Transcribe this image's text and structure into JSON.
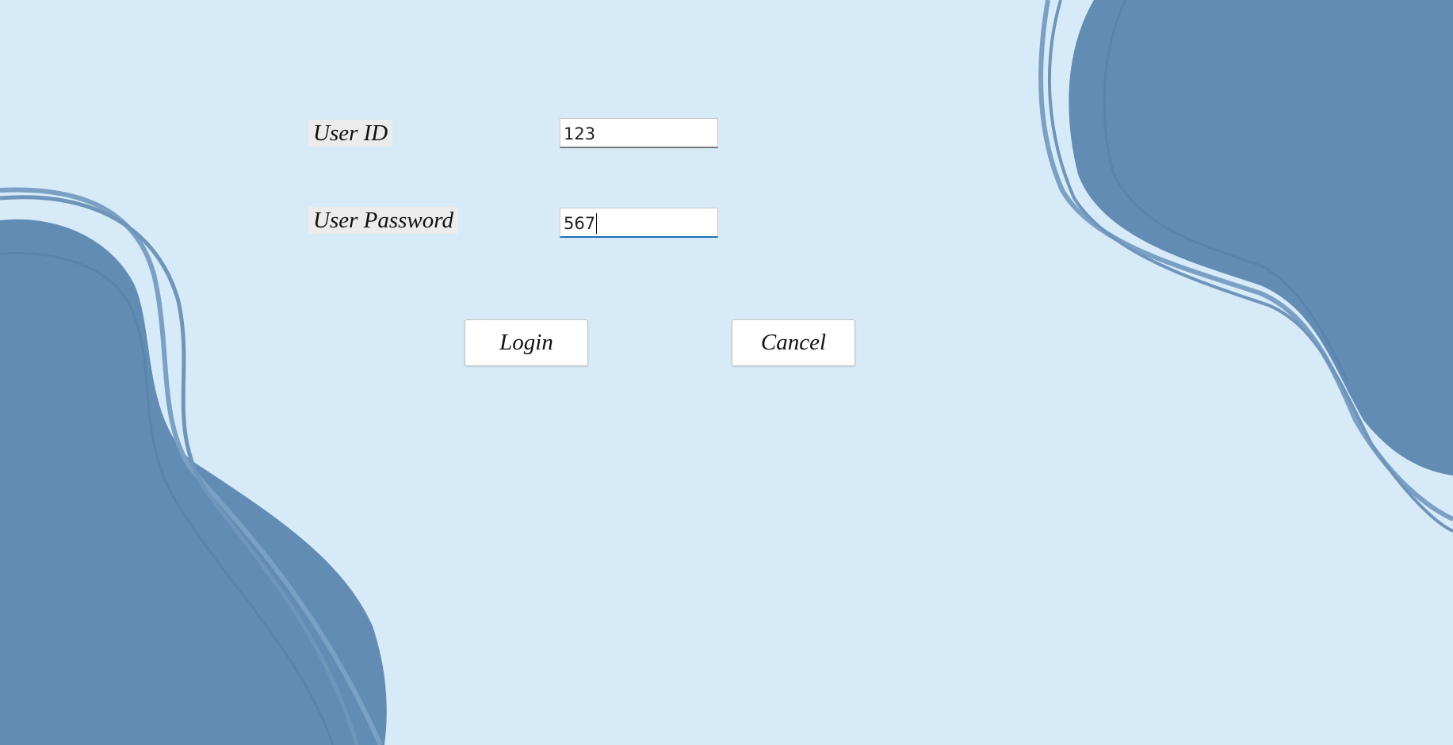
{
  "form": {
    "user_id_label": "User ID",
    "user_id_value": "123",
    "password_label": "User Password",
    "password_value": "567"
  },
  "buttons": {
    "login_label": "Login",
    "cancel_label": "Cancel"
  },
  "colors": {
    "background": "#d6eaf8",
    "blob_fill": "#628cb4",
    "blob_outline": "#7aa0c4",
    "label_background": "#ececec",
    "focus_underline": "#1e6fb8"
  }
}
